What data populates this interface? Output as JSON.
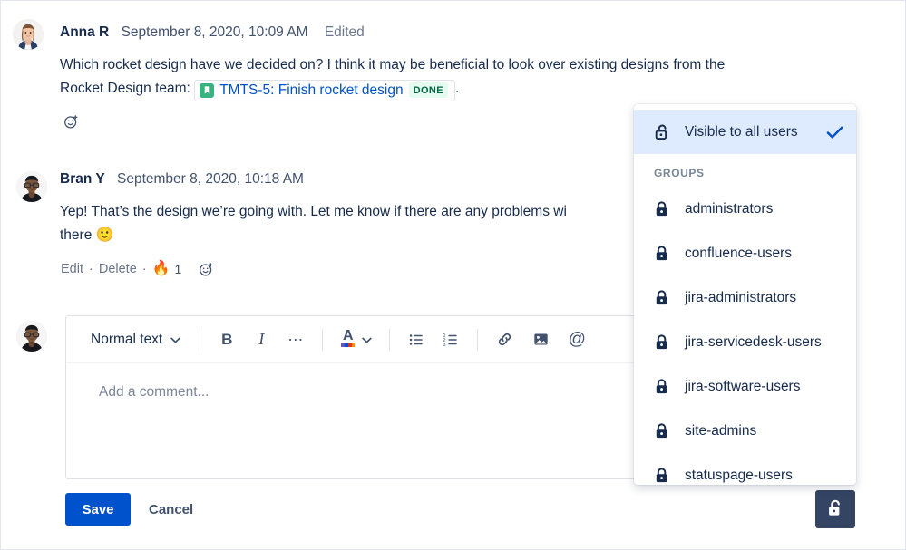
{
  "comments": [
    {
      "author": "Anna R",
      "timestamp": "September 8, 2020, 10:09 AM",
      "edited_label": "Edited",
      "body_part1": "Which rocket design have we decided on? I think it may be beneficial to look over existing designs from the",
      "body_part2": "Rocket Design team:",
      "issue_key_and_summary": "TMTS-5: Finish rocket design",
      "issue_status": "DONE",
      "body_part3": "."
    },
    {
      "author": "Bran Y",
      "timestamp": "September 8, 2020, 10:18 AM",
      "body_part1": "Yep! That’s the design we’re going with. Let me know if there are any problems wi",
      "body_part2": "there",
      "body_emoji": "🙂",
      "actions": {
        "edit": "Edit",
        "separator": "·",
        "delete": "Delete",
        "reaction_emoji": "🔥",
        "reaction_count": "1"
      }
    }
  ],
  "editor": {
    "style_select_value": "Normal text",
    "placeholder": "Add a comment...",
    "toolbar": {
      "bold_label": "B",
      "italic_label": "I",
      "more_label": "…",
      "text_color_label": "A",
      "mention_label": "@"
    }
  },
  "footer": {
    "save_label": "Save",
    "cancel_label": "Cancel"
  },
  "visibility_dropdown": {
    "all_users": {
      "label": "Visible to all users",
      "selected": true
    },
    "groups_section_title": "GROUPS",
    "groups": [
      {
        "label": "administrators"
      },
      {
        "label": "confluence-users"
      },
      {
        "label": "jira-administrators"
      },
      {
        "label": "jira-servicedesk-users"
      },
      {
        "label": "jira-software-users"
      },
      {
        "label": "site-admins"
      },
      {
        "label": "statuspage-users"
      }
    ]
  },
  "colors": {
    "link": "#0052CC",
    "primary_button": "#0052CC",
    "selected_row": "#DEEBFF",
    "status_done_bg": "#E3FCEF",
    "status_done_text": "#006644",
    "text": "#172B4D",
    "subtle_text": "#6B778C",
    "lock_button_bg": "#344563"
  }
}
